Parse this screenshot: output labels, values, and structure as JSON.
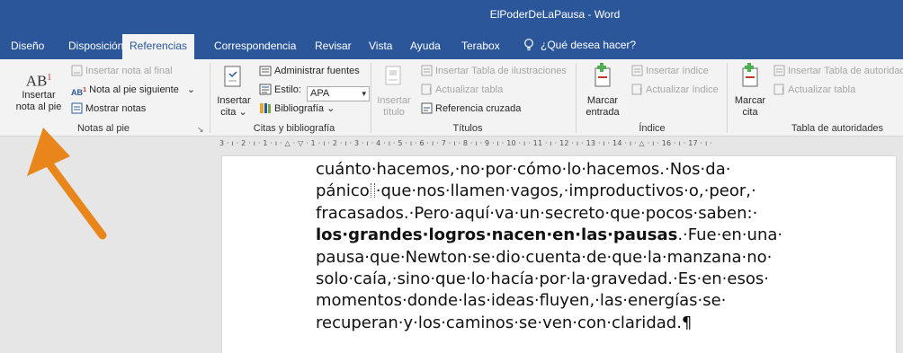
{
  "window": {
    "doc_name": "ElPoderDeLaPausa",
    "separator": "-",
    "app_name": "Word"
  },
  "tabs": [
    "Diseño",
    "Disposición",
    "Referencias",
    "Correspondencia",
    "Revisar",
    "Vista",
    "Ayuda",
    "Terabox"
  ],
  "active_tab": "Referencias",
  "tell_me": "¿Qué desea hacer?",
  "ribbon": {
    "notas": {
      "icon_text": "AB",
      "icon_sup": "1",
      "insert_footnote_1": "Insertar",
      "insert_footnote_2": "nota al pie",
      "insert_endnote": "Insertar nota al final",
      "next_footnote": "Nota al pie siguiente",
      "next_footnote_caret": "⌄",
      "show_notes": "Mostrar notas",
      "label": "Notas al pie",
      "launcher": "↘"
    },
    "citas": {
      "insert_citation_1": "Insertar",
      "insert_citation_2": "cita",
      "insert_citation_caret": "⌄",
      "manage_sources": "Administrar fuentes",
      "style_label": "Estilo:",
      "style_value": "APA",
      "style_caret": "▾",
      "bibliography": "Bibliografía",
      "bibliography_caret": "⌄",
      "label": "Citas y bibliografía"
    },
    "titulos": {
      "insert_caption_1": "Insertar",
      "insert_caption_2": "título",
      "insert_table_figures": "Insertar Tabla de ilustraciones",
      "update_table": "Actualizar tabla",
      "cross_reference": "Referencia cruzada",
      "label": "Títulos"
    },
    "indice": {
      "mark_entry_1": "Marcar",
      "mark_entry_2": "entrada",
      "insert_index": "Insertar índice",
      "update_index": "Actualizar índice",
      "label": "Índice"
    },
    "autoridades": {
      "mark_citation_1": "Marcar",
      "mark_citation_2": "cita",
      "insert_table_authorities": "Insertar Tabla de autoridades",
      "update_table": "Actualizar tabla",
      "label": "Tabla de autoridades"
    }
  },
  "ruler_text": "3 · ı · 2 · ı · 1 · ı · △ · ▽ · 1 · ı · 2 · ı · 3 · ı · 4 · ı · 5 · ı · 6 · ı · 7 · ı · 8 · ı · 9 · ı · 10 · ı · 11 · ı · 12 · ı · 13 · ı · 14 · ı · △ · ı · 16 · ı · 17 · ı ·",
  "document": {
    "line1": "cuánto·hacemos,·no·por·cómo·lo·hacemos.·Nos·da·",
    "line2a": "pánico",
    "line2b": "·que·nos·llamen·vagos,·improductivos·o,·peor,·",
    "line3": "fracasados.·Pero·aquí·va·un·secreto·que·pocos·saben:·",
    "line4_bold": "los·grandes·logros·nacen·en·las·pausas",
    "line4_rest": ".·Fue·en·una·",
    "line5": "pausa·que·Newton·se·dio·cuenta·de·que·la·manzana·no·",
    "line6": "solo·caía,·sino·que·lo·hacía·por·la·gravedad.·Es·en·esos·",
    "line7": "momentos·donde·las·ideas·fluyen,·las·energías·se·",
    "line8": "recuperan·y·los·caminos·se·ven·con·claridad.¶"
  },
  "colors": {
    "title_bar": "#2b579a",
    "ribbon": "#f3f3f3",
    "arrow": "#e8861b"
  }
}
